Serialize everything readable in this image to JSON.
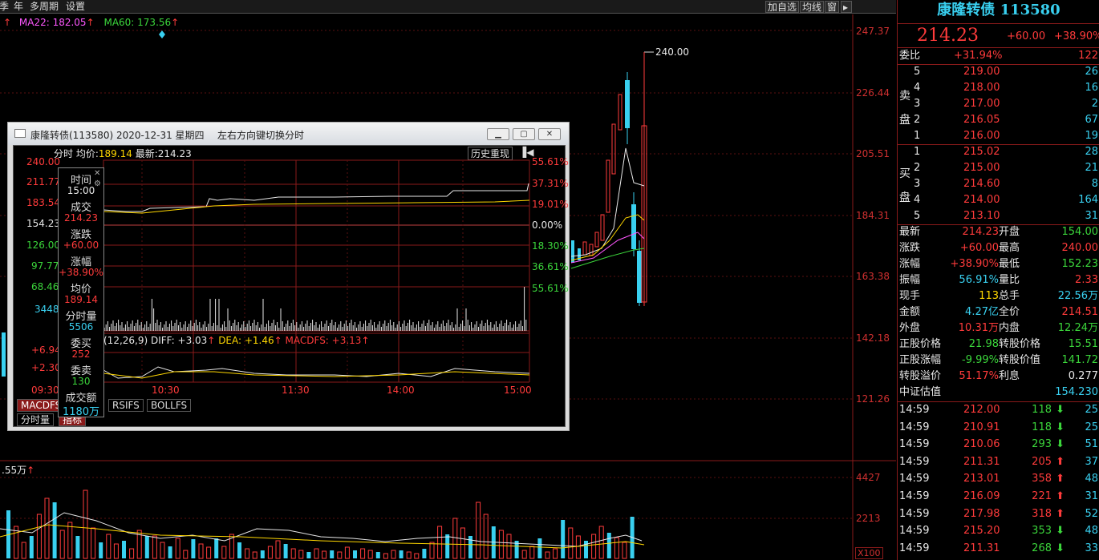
{
  "toolbar": {
    "left_items": [
      "季",
      "年",
      "多周期",
      "设置"
    ],
    "right_items": [
      "加自选",
      "均线",
      "窗"
    ],
    "more_arrow": "▸"
  },
  "ma_legend": {
    "ma22": "MA22: 182.05",
    "ma60": "MA60: 173.56",
    "arrow": "↑"
  },
  "main_axis": {
    "price_ticks": [
      "247.37",
      "226.44",
      "205.51",
      "184.31",
      "163.38",
      "142.18",
      "121.26"
    ],
    "volume_ticks": [
      "4427",
      "2213",
      "X100"
    ],
    "high_marker": "240.00"
  },
  "volume_panel": {
    "label": ".55万",
    "arrow": "↑"
  },
  "colors": {
    "up": "#ff3b3b",
    "down": "#39d0f0",
    "white": "#e8e8e8",
    "ma_yellow": "#ffd700",
    "ma_magenta": "#ff57ff",
    "ma_green": "#3bd63b",
    "frame": "#8a1a1a"
  },
  "popup": {
    "title": "康隆转债(113580)  2020-12-31  星期四",
    "hint": "左右方向键切换分时",
    "header": {
      "label": "分时",
      "avg_label": "均价:",
      "avg_value": "189.14",
      "last_label": "最新:",
      "last_value": "214.23"
    },
    "history_button": "历史重现",
    "left_prices": [
      "240.00",
      "211.77",
      "183.54",
      "154.23",
      "126.00",
      "97.77",
      "68.46"
    ],
    "right_pcts": [
      "55.61%",
      "37.31%",
      "19.01%",
      "0.00%",
      "18.30%",
      "36.61%",
      "55.61%"
    ],
    "volume_left": "3448",
    "macd_left": [
      "+6.94",
      "+2.30"
    ],
    "time_left": "09:30",
    "time_ticks": [
      "10:30",
      "11:30",
      "14:00",
      "15:00"
    ],
    "macd_legend": {
      "params": "(12,26,9)",
      "diff": "DIFF: +3.03",
      "dea": "DEA: +1.46",
      "macdfs": "MACDFS: +3.13",
      "arrow": "↑"
    },
    "tabs": [
      "MACDFS",
      "RSIFS",
      "BOLLFS"
    ],
    "bottom_tabs": [
      "分时量",
      "指标"
    ],
    "tooltip": [
      {
        "label": "时间",
        "value": "15:00",
        "color": "#e8e8e8"
      },
      {
        "label": "成交",
        "value": "214.23",
        "color": "#ff3b3b"
      },
      {
        "label": "涨跌",
        "value": "+60.00",
        "color": "#ff3b3b"
      },
      {
        "label": "涨幅",
        "value": "+38.90%",
        "color": "#ff3b3b"
      },
      {
        "label": "均价",
        "value": "189.14",
        "color": "#ff3b3b"
      },
      {
        "label": "分时量",
        "value": "5506",
        "color": "#39d0f0"
      },
      {
        "label": "委买",
        "value": "252",
        "color": "#ff3b3b"
      },
      {
        "label": "委卖",
        "value": "130",
        "color": "#3bd63b"
      },
      {
        "label": "成交额",
        "value": "1180万",
        "color": "#39d0f0"
      }
    ]
  },
  "quote": {
    "name": "康隆转债",
    "code": "113580",
    "price": "214.23",
    "change": "+60.00",
    "change_pct": "+38.90%",
    "weibi": {
      "label": "委比",
      "value": "+31.94%",
      "vol": "122"
    },
    "sell_side_label": [
      "卖",
      "盘"
    ],
    "buy_side_label": [
      "买",
      "盘"
    ],
    "sell": [
      {
        "lvl": "5",
        "price": "219.00",
        "vol": "26"
      },
      {
        "lvl": "4",
        "price": "218.00",
        "vol": "16"
      },
      {
        "lvl": "3",
        "price": "217.00",
        "vol": "2"
      },
      {
        "lvl": "2",
        "price": "216.05",
        "vol": "67"
      },
      {
        "lvl": "1",
        "price": "216.00",
        "vol": "19"
      }
    ],
    "buy": [
      {
        "lvl": "1",
        "price": "215.02",
        "vol": "28"
      },
      {
        "lvl": "2",
        "price": "215.00",
        "vol": "21"
      },
      {
        "lvl": "3",
        "price": "214.60",
        "vol": "8"
      },
      {
        "lvl": "4",
        "price": "214.00",
        "vol": "164"
      },
      {
        "lvl": "5",
        "price": "213.10",
        "vol": "31"
      }
    ],
    "stats": [
      {
        "l1": "最新",
        "v1": "214.23",
        "c1": "#ff3b3b",
        "l2": "开盘",
        "v2": "154.00",
        "c2": "#3bd63b"
      },
      {
        "l1": "涨跌",
        "v1": "+60.00",
        "c1": "#ff3b3b",
        "l2": "最高",
        "v2": "240.00",
        "c2": "#ff3b3b"
      },
      {
        "l1": "涨幅",
        "v1": "+38.90%",
        "c1": "#ff3b3b",
        "l2": "最低",
        "v2": "152.23",
        "c2": "#3bd63b"
      },
      {
        "l1": "振幅",
        "v1": "56.91%",
        "c1": "#39d0f0",
        "l2": "量比",
        "v2": "2.33",
        "c2": "#ff3b3b"
      },
      {
        "l1": "现手",
        "v1": "113",
        "c1": "#ffd700",
        "l2": "总手",
        "v2": "22.56万",
        "c2": "#39d0f0"
      },
      {
        "l1": "金额",
        "v1": "4.27亿",
        "c1": "#39d0f0",
        "l2": "全价",
        "v2": "214.51",
        "c2": "#ff3b3b"
      },
      {
        "l1": "外盘",
        "v1": "10.31万",
        "c1": "#ff3b3b",
        "l2": "内盘",
        "v2": "12.24万",
        "c2": "#3bd63b"
      },
      {
        "l1": "正股价格",
        "v1": "21.98",
        "c1": "#3bd63b",
        "l2": "转股价格",
        "v2": "15.51",
        "c2": "#3bd63b"
      },
      {
        "l1": "正股涨幅",
        "v1": "-9.99%",
        "c1": "#3bd63b",
        "l2": "转股价值",
        "v2": "141.72",
        "c2": "#3bd63b"
      },
      {
        "l1": "转股溢价",
        "v1": "51.17%",
        "c1": "#ff3b3b",
        "l2": "利息",
        "v2": "0.277",
        "c2": "#e8e8e8"
      }
    ],
    "valuation": {
      "label": "中证估值",
      "value": "154.230"
    },
    "ticks": [
      {
        "time": "14:59",
        "price": "212.00",
        "vol": "118",
        "dir": "down",
        "n": "25"
      },
      {
        "time": "14:59",
        "price": "210.91",
        "vol": "118",
        "dir": "down",
        "n": "25"
      },
      {
        "time": "14:59",
        "price": "210.06",
        "vol": "293",
        "dir": "down",
        "n": "51"
      },
      {
        "time": "14:59",
        "price": "211.31",
        "vol": "205",
        "dir": "up",
        "n": "37"
      },
      {
        "time": "14:59",
        "price": "213.01",
        "vol": "358",
        "dir": "up",
        "n": "48"
      },
      {
        "time": "14:59",
        "price": "216.09",
        "vol": "221",
        "dir": "up",
        "n": "31"
      },
      {
        "time": "14:59",
        "price": "217.98",
        "vol": "318",
        "dir": "up",
        "n": "52"
      },
      {
        "time": "14:59",
        "price": "215.20",
        "vol": "353",
        "dir": "down",
        "n": "48"
      },
      {
        "time": "14:59",
        "price": "211.31",
        "vol": "268",
        "dir": "down",
        "n": "33"
      }
    ]
  }
}
